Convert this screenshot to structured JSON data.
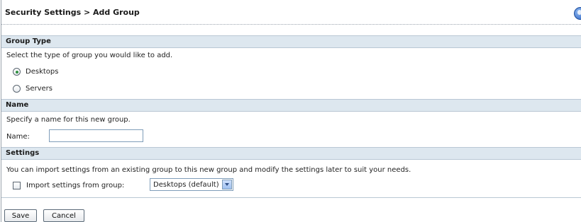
{
  "header": {
    "title": "Security Settings > Add Group",
    "help_icon": "help-icon"
  },
  "group_type": {
    "heading": "Group Type",
    "description": "Select the type of group you would like to add.",
    "options": [
      {
        "label": "Desktops",
        "checked": true
      },
      {
        "label": "Servers",
        "checked": false
      }
    ]
  },
  "name_section": {
    "heading": "Name",
    "description": "Specify a name for this new group.",
    "field_label": "Name:",
    "field_value": ""
  },
  "settings": {
    "heading": "Settings",
    "description": "You can import settings from an existing group to this new group and modify the settings later to suit your needs.",
    "import_label": "Import settings from group:",
    "import_checked": false,
    "group_select_value": "Desktops (default)"
  },
  "buttons": {
    "save": "Save",
    "cancel": "Cancel"
  }
}
